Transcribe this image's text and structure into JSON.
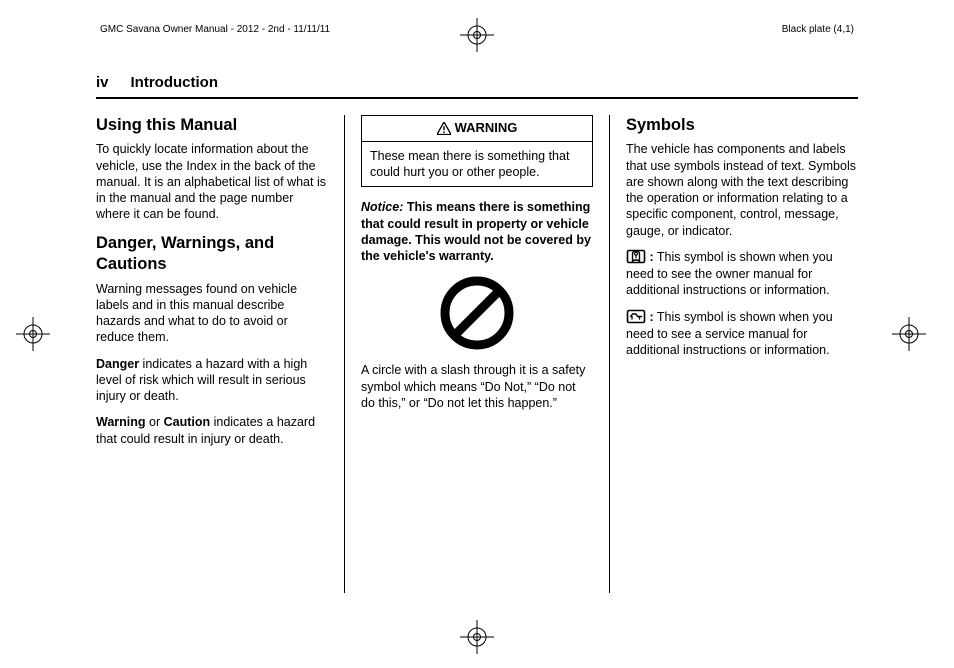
{
  "print": {
    "doc_title": "GMC Savana Owner Manual - 2012 - 2nd - 11/11/11",
    "plate": "Black plate (4,1)"
  },
  "head": {
    "page_roman": "iv",
    "section": "Introduction"
  },
  "col1": {
    "h1": "Using this Manual",
    "p1": "To quickly locate information about the vehicle, use the Index in the back of the manual. It is an alphabetical list of what is in the manual and the page number where it can be found.",
    "h2": "Danger, Warnings, and Cautions",
    "p2": "Warning messages found on vehicle labels and in this manual describe hazards and what to do to avoid or reduce them.",
    "p3a": "Danger",
    "p3b": " indicates a hazard with a high level of risk which will result in serious injury or death.",
    "p4a": "Warning",
    "p4b": " or ",
    "p4c": "Caution",
    "p4d": " indicates a hazard that could result in injury or death."
  },
  "col2": {
    "warn_title": "WARNING",
    "warn_body": "These mean there is something that could hurt you or other people.",
    "notice_label": "Notice:",
    "notice_text": " This means there is something that could result in property or vehicle damage. This would not be covered by the vehicle's warranty.",
    "symbol_desc": "A circle with a slash through it is a safety symbol which means “Do Not,” “Do not do this,” or “Do not let this happen.”"
  },
  "col3": {
    "h1": "Symbols",
    "p1": "The vehicle has components and labels that use symbols instead of text. Symbols are shown along with the text describing the operation or information relating to a specific component, control, message, gauge, or indicator.",
    "sym1_colon": ":",
    "sym1_text": "  This symbol is shown when you need to see the owner manual for additional instructions or information.",
    "sym2_colon": ":",
    "sym2_text": "  This symbol is shown when you need to see a service manual for additional instructions or information."
  }
}
